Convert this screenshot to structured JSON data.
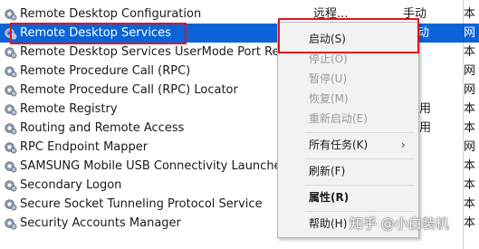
{
  "services": [
    {
      "name": "Remote Desktop Configuration",
      "desc": "远程...",
      "status": "手动",
      "startup": "本"
    },
    {
      "name": "Remote Desktop Services",
      "desc": "",
      "status": "动",
      "startup": "网"
    },
    {
      "name": "Remote Desktop Services UserMode Port Redire",
      "desc": "",
      "status": "",
      "startup": "本"
    },
    {
      "name": "Remote Procedure Call (RPC)",
      "desc": "",
      "status": "",
      "startup": "网"
    },
    {
      "name": "Remote Procedure Call (RPC) Locator",
      "desc": "",
      "status": "",
      "startup": "网"
    },
    {
      "name": "Remote Registry",
      "desc": "",
      "status": "用",
      "startup": "本"
    },
    {
      "name": "Routing and Remote Access",
      "desc": "",
      "status": "用",
      "startup": "本"
    },
    {
      "name": "RPC Endpoint Mapper",
      "desc": "",
      "status": "",
      "startup": "网"
    },
    {
      "name": "SAMSUNG Mobile USB Connectivity Launcher",
      "desc": "",
      "status": "",
      "startup": "本"
    },
    {
      "name": "Secondary Logon",
      "desc": "",
      "status": "",
      "startup": "本"
    },
    {
      "name": "Secure Socket Tunneling Protocol Service",
      "desc": "",
      "status": "",
      "startup": "本"
    },
    {
      "name": "Security Accounts Manager",
      "desc": "",
      "status": "",
      "startup": "本"
    }
  ],
  "context_menu": {
    "start": "启动(S)",
    "stop": "停止(O)",
    "pause": "暂停(U)",
    "resume": "恢复(M)",
    "restart": "重新启动(E)",
    "all_tasks": "所有任务(K)",
    "refresh": "刷新(F)",
    "properties": "属性(R)",
    "help": "帮助(H)"
  },
  "watermark": "知乎 @小白装机"
}
